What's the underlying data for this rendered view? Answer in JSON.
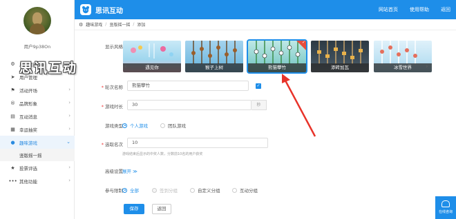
{
  "sidebar": {
    "username": "用户9p38On",
    "items": [
      {
        "label": "用户管理",
        "icon": "settings-icon",
        "arrow": false
      },
      {
        "label": "用户管理",
        "icon": "send-icon",
        "arrow": false
      },
      {
        "label": "活动开场",
        "icon": "flag-icon",
        "arrow": true
      },
      {
        "label": "品牌形象",
        "icon": "registered-icon",
        "arrow": true
      },
      {
        "label": "互动消息",
        "icon": "chat-icon",
        "arrow": true
      },
      {
        "label": "幸运抽奖",
        "icon": "gift-icon",
        "arrow": true
      },
      {
        "label": "趣味游戏",
        "icon": "game-icon",
        "arrow": true,
        "active": true
      },
      {
        "label": "投票评选",
        "icon": "star-icon",
        "arrow": true
      },
      {
        "label": "其他功能",
        "icon": "more-icon",
        "arrow": true
      }
    ],
    "submenu": "竖版摇一摇",
    "watermark": "思讯互动"
  },
  "header": {
    "logo_text": "思讯互动",
    "links": [
      "网站首页",
      "使用帮助",
      "返回"
    ]
  },
  "breadcrumb": [
    "趣味游戏",
    "竖版摇一摇",
    "添加"
  ],
  "form": {
    "style_label": "显示风格",
    "styles": [
      {
        "name": "遇见你",
        "selected": false
      },
      {
        "name": "猴子上树",
        "selected": false
      },
      {
        "name": "熊猫攀竹",
        "selected": true
      },
      {
        "name": "添砖加瓦",
        "selected": false
      },
      {
        "name": "冰雪世界",
        "selected": false
      }
    ],
    "round_label": "轮次名称",
    "round_value": "熊猫攀竹",
    "duration_label": "游戏时长",
    "duration_value": "30",
    "duration_unit": "秒",
    "type_label": "游戏类型",
    "type_options": [
      "个人游戏",
      "团队游戏"
    ],
    "rank_label": "选取名次",
    "rank_value": "10",
    "rank_hint": "游戏结束后显示的中奖人数，分数前10名的用户获奖",
    "advanced_label": "高级设置",
    "advanced_toggle": "展开 ≫",
    "limit_label": "参与限制",
    "limit_options": [
      "全部",
      "签到分组",
      "自定义分组",
      "互动分组"
    ],
    "save_button": "保存",
    "back_button": "返回"
  },
  "chat": {
    "label": "在线咨询"
  },
  "colors": {
    "primary": "#1e8ee9",
    "arrow": "#e8332a"
  }
}
